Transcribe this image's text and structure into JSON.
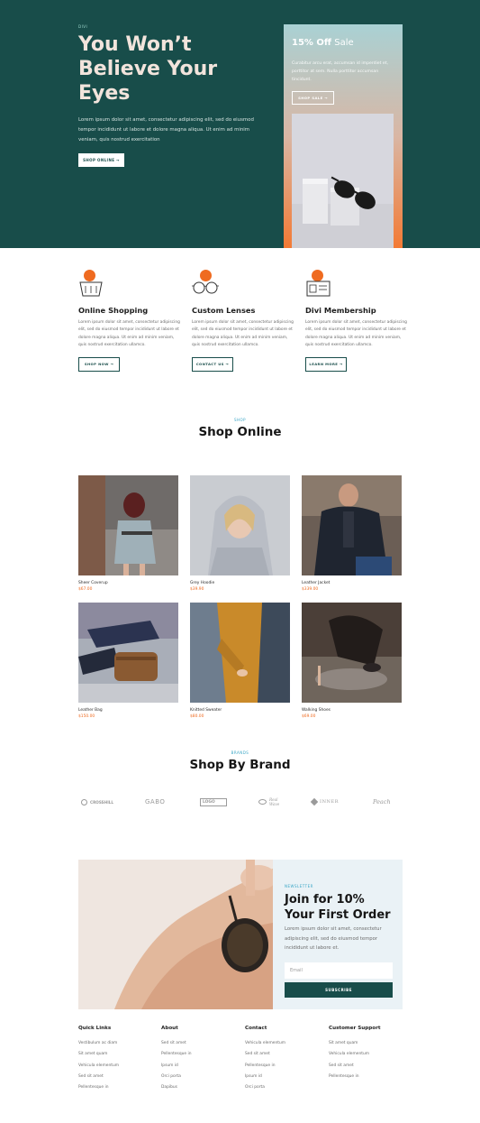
{
  "hero": {
    "eyebrow": "DIVI",
    "title": "You Won’t Believe Your Eyes",
    "lead": "Lorem ipsum dolor sit amet, consectetur adipiscing elit, sed do eiusmod tempor incididunt ut labore et dolore magna aliqua. Ut enim ad minim veniam, quis nostrud exercitation",
    "cta": "SHOP ONLINE →"
  },
  "promo": {
    "percent": "15% Off",
    "label": "Sale",
    "text": "Curabitur arcu erat, accumsan id imperdiet et, porttitor at sem. Nulla porttitor accumsan tincidunt.",
    "cta": "SHOP SALE →"
  },
  "features": [
    {
      "icon": "basket-icon",
      "title": "Online Shopping",
      "text": "Lorem ipsum dolor sit amet, consectetur adipiscing elit, sed do eiusmod tempor incididunt ut labore et dolore magna aliqua. Ut enim ad minim veniam, quis nostrud exercitation ullamco.",
      "cta": "SHOP NOW →"
    },
    {
      "icon": "glasses-icon",
      "title": "Custom Lenses",
      "text": "Lorem ipsum dolor sit amet, consectetur adipiscing elit, sed do eiusmod tempor incididunt ut labore et dolore magna aliqua. Ut enim ad minim veniam, quis nostrud exercitation ullamco.",
      "cta": "CONTACT US →"
    },
    {
      "icon": "membership-card-icon",
      "title": "Divi Membership",
      "text": "Lorem ipsum dolor sit amet, consectetur adipiscing elit, sed do eiusmod tempor incididunt ut labore et dolore magna aliqua. Ut enim ad minim veniam, quis nostrud exercitation ullamco.",
      "cta": "LEARN MORE →"
    }
  ],
  "shop": {
    "eyebrow": "SHOP",
    "title": "Shop Online",
    "products": [
      {
        "name": "Sheer Coverup",
        "price": "$67.00"
      },
      {
        "name": "Grey Hoodie",
        "price": "$39.90"
      },
      {
        "name": "Leather Jacket",
        "price": "$339.00"
      },
      {
        "name": "Leather Bag",
        "price": "$150.00"
      },
      {
        "name": "Knitted Sweater",
        "price": "$80.00"
      },
      {
        "name": "Walking Shoes",
        "price": "$69.00"
      }
    ]
  },
  "brands": {
    "eyebrow": "BRANDS",
    "title": "Shop By Brand",
    "items": [
      "CROSSHILL",
      "GABO",
      "LOGO",
      "Real Wave",
      "INNER",
      "Peach"
    ]
  },
  "newsletter": {
    "eyebrow": "NEWSLETTER",
    "title": "Join for 10% Your First Order",
    "text": "Lorem ipsum dolor sit amet, consectetur adipiscing elit, sed do eiusmod tempor incididunt ut labore et.",
    "placeholder": "Email",
    "cta": "SUBSCRIBE"
  },
  "footer": {
    "columns": [
      {
        "title": "Quick Links",
        "links": [
          "Vestibulum ac diam",
          "Sit amet quam",
          "Vehicula elementum",
          "Sed sit amet",
          "Pellentesque in"
        ]
      },
      {
        "title": "About",
        "links": [
          "Sed sit amet",
          "Pellentesque in",
          "Ipsum id",
          "Orci porta",
          "Dapibus"
        ]
      },
      {
        "title": "Contact",
        "links": [
          "Vehicula elementum",
          "Sed sit amet",
          "Pellentesque in",
          "Ipsum id",
          "Orci porta"
        ]
      },
      {
        "title": "Customer Support",
        "links": [
          "Sit amet quam",
          "Vehicula elementum",
          "Sed sit amet",
          "Pellentesque in"
        ]
      }
    ]
  },
  "colors": {
    "hero_bg": "#184d4a",
    "accent_orange": "#ef6b20",
    "accent_blue": "#3aa6c6",
    "newsletter_bg": "#eaf2f6"
  }
}
